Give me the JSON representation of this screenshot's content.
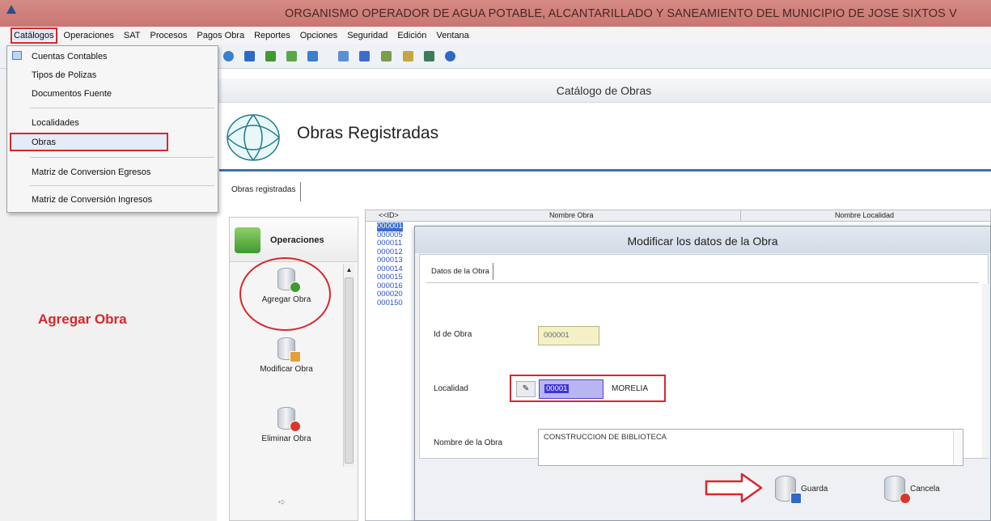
{
  "window": {
    "title": "ORGANISMO OPERADOR DE AGUA POTABLE, ALCANTARILLADO Y SANEAMIENTO DEL MUNICIPIO DE JOSE SIXTOS V"
  },
  "menubar": {
    "items": [
      "Catálogos",
      "Operaciones",
      "SAT",
      "Procesos",
      "Pagos Obra",
      "Reportes",
      "Opciones",
      "Seguridad",
      "Edición",
      "Ventana"
    ]
  },
  "dropdown": {
    "items": [
      "Cuentas Contables",
      "Tipos de Polizas",
      "Documentos Fuente",
      "Localidades",
      "Obras",
      "Matriz de Conversion Egresos",
      "Matriz de Conversión Ingresos"
    ]
  },
  "annotation": {
    "agregar_label": "Agregar Obra"
  },
  "content": {
    "header": "Catálogo de Obras",
    "title": "Obras Registradas",
    "tab": "Obras registradas"
  },
  "operations": {
    "header": "Operaciones",
    "buttons": [
      "Agregar Obra",
      "Modificar Obra",
      "Eliminar Obra"
    ]
  },
  "grid": {
    "columns": [
      "<<ID>",
      "Nombre Obra",
      "Nombre Localidad"
    ],
    "ids": [
      "000001",
      "000005",
      "000011",
      "000012",
      "000013",
      "000014",
      "000015",
      "000016",
      "000020",
      "000150"
    ]
  },
  "modal": {
    "title": "Modificar los datos de la Obra",
    "tab": "Datos de la Obra",
    "id_label": "Id de Obra",
    "id_value": "000001",
    "localidad_label": "Localidad",
    "localidad_code": "00001",
    "localidad_name": "MORELIA",
    "nombre_label": "Nombre de la Obra",
    "nombre_value": "CONSTRUCCION DE BIBLIOTECA",
    "save_label": "Guarda",
    "cancel_label": "Cancela"
  },
  "colors": {
    "accent_red": "#d9262b",
    "title_bar": "#c97671",
    "rule_blue": "#3f6fb0",
    "grid_text": "#2b54c4"
  }
}
